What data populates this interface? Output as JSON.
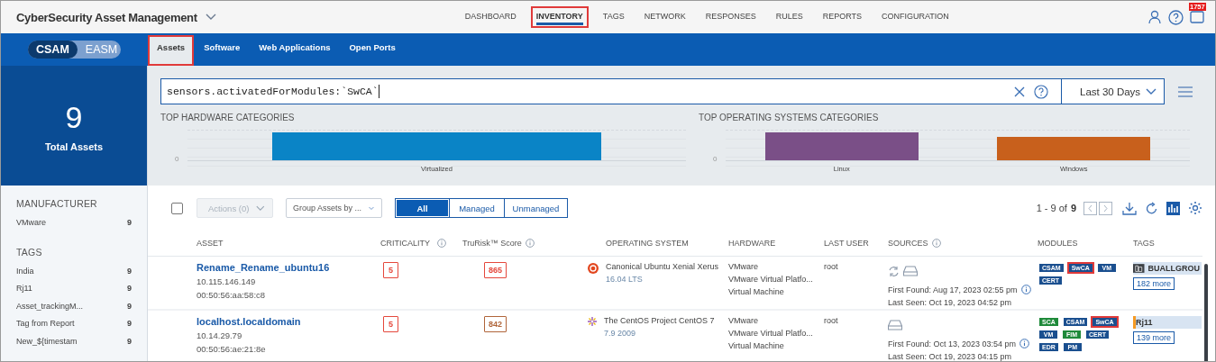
{
  "app": {
    "title": "CyberSecurity Asset Management"
  },
  "nav": [
    {
      "label": "DASHBOARD",
      "selected": false,
      "highlighted": false
    },
    {
      "label": "INVENTORY",
      "selected": true,
      "highlighted": true
    },
    {
      "label": "TAGS",
      "selected": false,
      "highlighted": false
    },
    {
      "label": "NETWORK",
      "selected": false,
      "highlighted": false
    },
    {
      "label": "RESPONSES",
      "selected": false,
      "highlighted": false
    },
    {
      "label": "RULES",
      "selected": false,
      "highlighted": false
    },
    {
      "label": "REPORTS",
      "selected": false,
      "highlighted": false
    },
    {
      "label": "CONFIGURATION",
      "selected": false,
      "highlighted": false
    }
  ],
  "notification_badge": "1757",
  "app_switch": [
    {
      "label": "CSAM",
      "selected": true
    },
    {
      "label": "EASM",
      "selected": false
    }
  ],
  "subtabs": [
    {
      "label": "Assets",
      "selected": true,
      "highlighted": true
    },
    {
      "label": "Software",
      "selected": false,
      "highlighted": false
    },
    {
      "label": "Web Applications",
      "selected": false,
      "highlighted": false
    },
    {
      "label": "Open Ports",
      "selected": false,
      "highlighted": false
    }
  ],
  "summary": {
    "count": "9",
    "label": "Total Assets"
  },
  "filters": [
    {
      "title": "MANUFACTURER",
      "items": [
        {
          "label": "VMware",
          "count": "9"
        }
      ]
    },
    {
      "title": "TAGS",
      "items": [
        {
          "label": "India",
          "count": "9"
        },
        {
          "label": "Rj11",
          "count": "9"
        },
        {
          "label": "Asset_trackingM...",
          "count": "9"
        },
        {
          "label": "Tag from Report",
          "count": "9"
        },
        {
          "label": "New_${timestam",
          "count": "9"
        }
      ]
    }
  ],
  "search": {
    "value": "sensors.activatedForModules:`SwCA`"
  },
  "date_range": "Last 30 Days",
  "charts": [
    {
      "title": "TOP HARDWARE CATEGORIES",
      "zero_label": "0",
      "bars": [
        {
          "label": "Virtualized",
          "color": "#0a84c6"
        }
      ]
    },
    {
      "title": "TOP OPERATING SYSTEMS CATEGORIES",
      "zero_label": "0",
      "bars": [
        {
          "label": "Linux",
          "color": "#7a4f87"
        },
        {
          "label": "Windows",
          "color": "#c8601c"
        }
      ]
    }
  ],
  "toolbar": {
    "actions": "Actions (0)",
    "actions_disabled": true,
    "group_by": "Group Assets by ...",
    "select_all_checked": false,
    "segments": [
      {
        "label": "All",
        "selected": true
      },
      {
        "label": "Managed",
        "selected": false
      },
      {
        "label": "Unmanaged",
        "selected": false
      }
    ],
    "range": "1 - 9 of",
    "total": "9"
  },
  "table": {
    "columns": [
      {
        "label": "ASSET",
        "info": false
      },
      {
        "label": "CRITICALITY",
        "info": true
      },
      {
        "label": "TruRisk™ Score",
        "info": true
      },
      {
        "label": "OPERATING SYSTEM",
        "info": false
      },
      {
        "label": "HARDWARE",
        "info": false
      },
      {
        "label": "LAST USER",
        "info": false
      },
      {
        "label": "SOURCES",
        "info": true
      },
      {
        "label": "MODULES",
        "info": false
      },
      {
        "label": "TAGS",
        "info": false
      }
    ],
    "rows": [
      {
        "name": "Rename_Rename_ubuntu16",
        "ip": "10.115.146.149",
        "mac": "00:50:56:aa:58:c8",
        "criticality": "5",
        "score": {
          "label": "865",
          "color": "#e5483c"
        },
        "os": {
          "kind": "ubuntu",
          "name": "Canonical Ubuntu Xenial Xerus",
          "version": "16.04 LTS"
        },
        "hardware": [
          "VMware",
          "VMware Virtual Platfo...",
          "Virtual Machine"
        ],
        "last_user": "root",
        "sources": [
          {
            "kind": "sync"
          },
          {
            "kind": "drive"
          }
        ],
        "first_found": "First Found: Aug 17, 2023 02:55 pm",
        "last_seen": "Last Seen: Oct 19, 2023 04:52 pm",
        "modules": [
          {
            "label": "CSAM",
            "color": "#1a4f8f",
            "highlighted": false
          },
          {
            "label": "SwCA",
            "color": "#1a4f8f",
            "highlighted": true
          },
          {
            "label": "VM",
            "color": "#1a4f8f",
            "highlighted": false
          },
          {
            "label": "CERT",
            "color": "#1a4f8f",
            "highlighted": false
          }
        ],
        "tag": {
          "label": "BUALLGROU",
          "kind": "icon",
          "color": "#3d4146"
        },
        "more": "182 more"
      },
      {
        "name": "localhost.localdomain",
        "ip": "10.14.29.79",
        "mac": "00:50:56:ae:21:8e",
        "criticality": "5",
        "score": {
          "label": "842",
          "color": "#b0653a"
        },
        "os": {
          "kind": "centos",
          "name": "The CentOS Project CentOS 7",
          "version": "7.9 2009"
        },
        "hardware": [
          "VMware",
          "VMware Virtual Platfo...",
          "Virtual Machine"
        ],
        "last_user": "root",
        "sources": [
          {
            "kind": "drive"
          }
        ],
        "first_found": "First Found: Oct 13, 2023 03:54 pm",
        "last_seen": "Last Seen: Oct 19, 2023 04:15 pm",
        "modules": [
          {
            "label": "SCA",
            "color": "#1f8a3a",
            "highlighted": false
          },
          {
            "label": "CSAM",
            "color": "#1a4f8f",
            "highlighted": false
          },
          {
            "label": "SwCA",
            "color": "#1a4f8f",
            "highlighted": true
          },
          {
            "label": "VM",
            "color": "#1a4f8f",
            "highlighted": false
          },
          {
            "label": "FIM",
            "color": "#1f8a3a",
            "highlighted": false
          },
          {
            "label": "CERT",
            "color": "#1a4f8f",
            "highlighted": false
          },
          {
            "label": "EDR",
            "color": "#1a4f8f",
            "highlighted": false
          },
          {
            "label": "PM",
            "color": "#1a4f8f",
            "highlighted": false
          }
        ],
        "tag": {
          "label": "Rj11",
          "kind": "bar",
          "color": "#f59a23"
        },
        "more": "139 more"
      }
    ]
  }
}
